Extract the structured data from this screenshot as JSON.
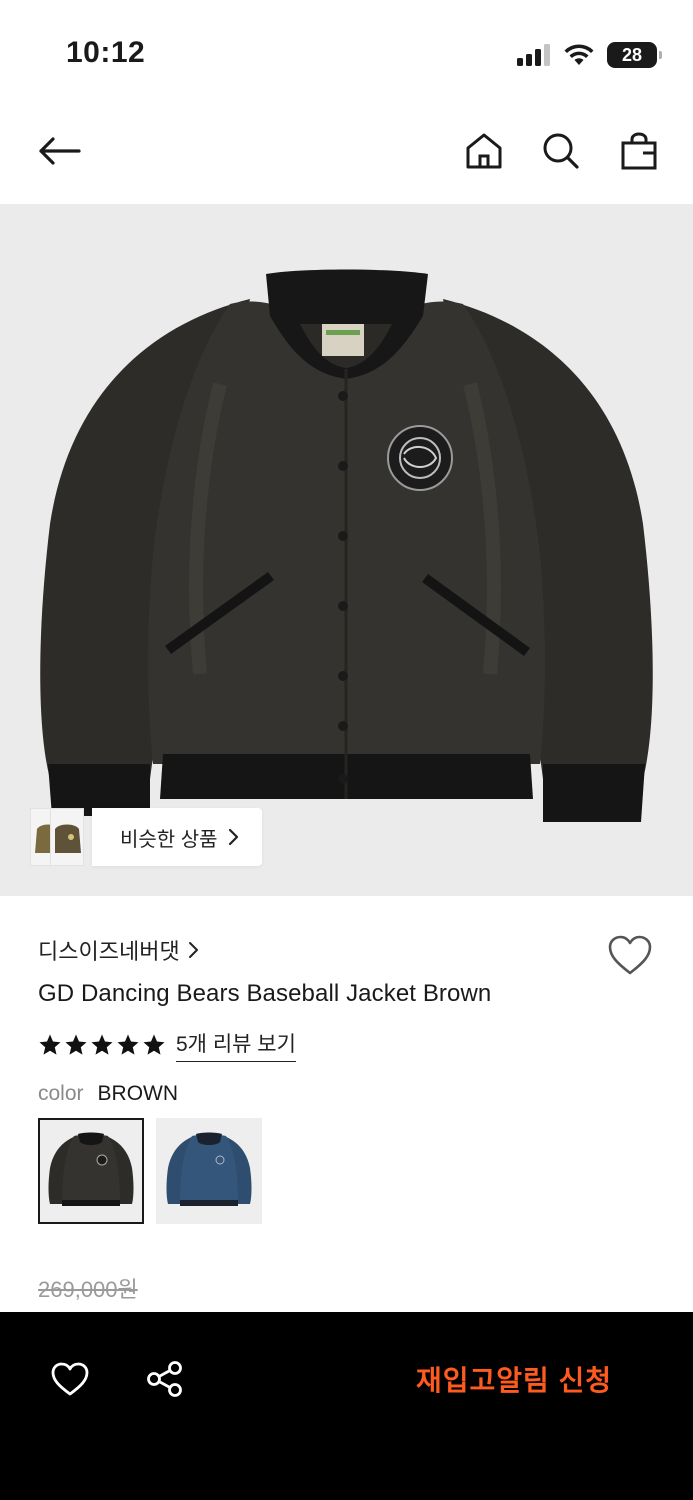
{
  "status_bar": {
    "time": "10:12",
    "battery": "28",
    "icons": [
      "signal-icon",
      "wifi-icon",
      "battery-icon"
    ]
  },
  "nav": {
    "icons": [
      "back-arrow-icon",
      "home-icon",
      "search-icon",
      "shopping-bag-icon"
    ]
  },
  "product": {
    "image_icon": "jacket-image",
    "similar_label": "비슷한 상품",
    "brand": "디스이즈네버댓",
    "title": "GD Dancing Bears Baseball Jacket Brown",
    "rating_stars": 5,
    "review_link": "5개 리뷰 보기",
    "color_label": "color",
    "color_value": "BROWN",
    "swatches": [
      {
        "name": "brown",
        "color": "#3a3833",
        "selected": true
      },
      {
        "name": "blue",
        "color": "#2f4d6e",
        "selected": false
      }
    ],
    "original_price": "269,000원"
  },
  "bottom_bar": {
    "restock_label": "재입고알림 신청",
    "accent_color": "#ff5a1f"
  }
}
